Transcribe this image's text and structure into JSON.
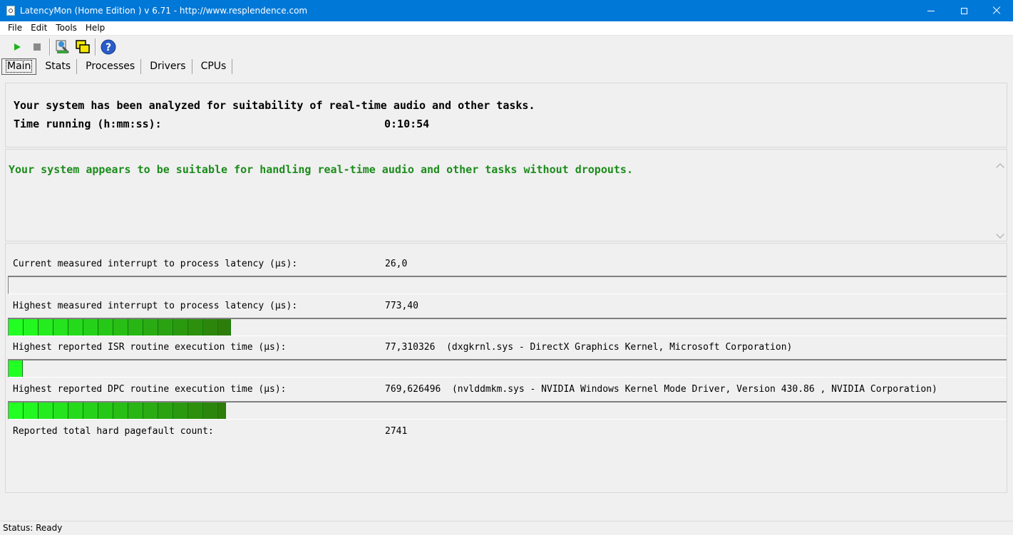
{
  "window": {
    "title": "LatencyMon  (Home Edition )  v 6.71 - http://www.resplendence.com"
  },
  "menu": [
    "File",
    "Edit",
    "Tools",
    "Help"
  ],
  "toolbar": {
    "icons": [
      "play-icon",
      "stop-icon",
      "report-icon",
      "windows-icon",
      "help-icon"
    ]
  },
  "tabs": [
    "Main",
    "Stats",
    "Processes",
    "Drivers",
    "CPUs"
  ],
  "summary": {
    "analyzed_text": "Your system has been analyzed for suitability of real-time audio and other tasks.",
    "time_label": "Time running (h:mm:ss):",
    "time_value": "0:10:54"
  },
  "verdict": {
    "text": "Your system appears to be suitable for handling real-time audio and other tasks without dropouts.",
    "color": "#1c8c1c"
  },
  "metrics": [
    {
      "label": "Current measured interrupt to process latency (µs):",
      "value": "26,0",
      "detail": "",
      "level": 0.0
    },
    {
      "label": "Highest measured interrupt to process latency (µs):",
      "value": "773,40",
      "detail": "",
      "level": 0.223
    },
    {
      "label": "Highest reported ISR routine execution time (µs):",
      "value": "77,310326",
      "detail": "(dxgkrnl.sys - DirectX Graphics Kernel, Microsoft Corporation)",
      "level": 0.014
    },
    {
      "label": "Highest reported DPC routine execution time (µs):",
      "value": "769,626496",
      "detail": "(nvlddmkm.sys - NVIDIA Windows Kernel Mode Driver, Version 430.86 , NVIDIA Corporation)",
      "level": 0.218
    }
  ],
  "pagefault": {
    "label": "Reported total hard pagefault count:",
    "value": "2741"
  },
  "status": {
    "text": "Status: Ready"
  },
  "colors": {
    "bar_light": "#22ff22",
    "bar_dark": "#2e7d0a"
  }
}
